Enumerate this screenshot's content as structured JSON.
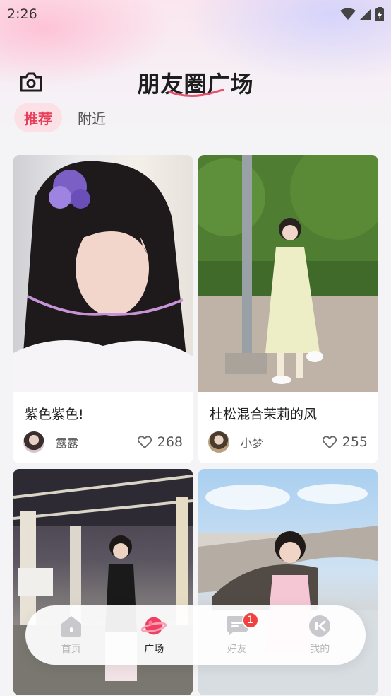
{
  "status_bar": {
    "time": "2:26"
  },
  "header": {
    "title": "朋友圈广场"
  },
  "tabs": [
    {
      "label": "推荐",
      "active": true
    },
    {
      "label": "附近",
      "active": false
    }
  ],
  "posts": [
    {
      "caption": "紫色紫色!",
      "author": "露露",
      "likes": "268"
    },
    {
      "caption": "杜松混合茉莉的风",
      "author": "小梦",
      "likes": "255"
    },
    {
      "caption": "",
      "author": "",
      "likes": ""
    },
    {
      "caption": "",
      "author": "",
      "likes": ""
    }
  ],
  "bottom_nav": {
    "items": [
      {
        "label": "首页",
        "icon": "home-icon",
        "active": false
      },
      {
        "label": "广场",
        "icon": "planet-icon",
        "active": true
      },
      {
        "label": "好友",
        "icon": "chat-icon",
        "active": false,
        "badge": "1"
      },
      {
        "label": "我的",
        "icon": "profile-icon",
        "active": false
      }
    ]
  },
  "colors": {
    "accent": "#e83e5a",
    "badge": "#f0423f",
    "tab_bg": "#fbe1e6"
  }
}
